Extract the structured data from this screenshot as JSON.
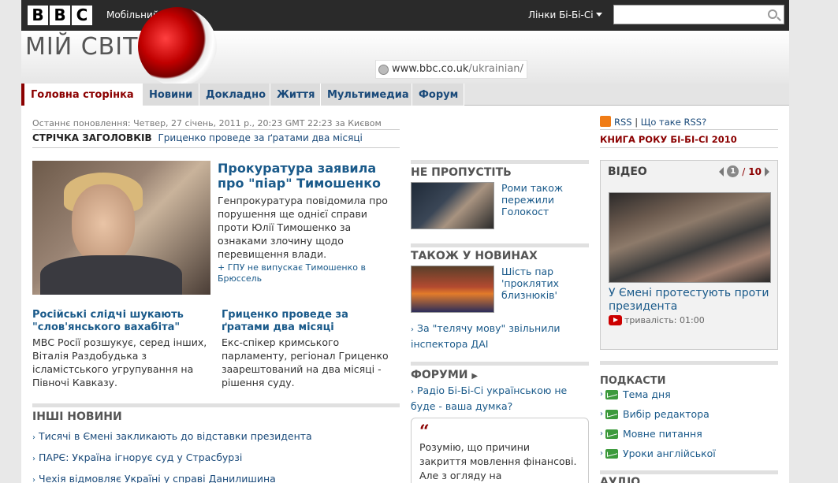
{
  "header": {
    "logo_letters": [
      "B",
      "B",
      "C"
    ],
    "mobile_label": "Мобільний",
    "links_label": "Лінки Бі-Бі-Сі",
    "search_placeholder": ""
  },
  "banner": {
    "brand": "МІЙ СВІТ",
    "url_prefix": "www.bbc.co.uk",
    "url_suffix": "/ukrainian/"
  },
  "nav": {
    "tabs": [
      "Головна сторінка",
      "Новини",
      "Докладно",
      "Життя",
      "Мультимедиа",
      "Форум"
    ],
    "active_index": 0
  },
  "updated": "Останнє поновлення: Четвер, 27 січень, 2011 р., 20:23 GMT 22:23 за Києвом",
  "ticker": {
    "label": "СТРІЧКА ЗАГОЛОВКІВ",
    "headline": "Гриценко проведе за ґратами два місяці"
  },
  "lead": {
    "title": "Прокуратура заявила про \"піар\" Тимошенко",
    "text": "Генпрокуратура повідомила про порушення ще однієї справи проти Юлії Тимошенко за ознаками злочину щодо перевищення влади.",
    "sub_link": "ГПУ не випускає Тимошенко в Брюссель"
  },
  "stories": [
    {
      "title": "Російські слідчі шукають \"слов'янського вахабіта\"",
      "text": "МВС Росії розшукує, серед інших, Віталія Раздобудька з ісламістського угрупування на Півночі Кавказу."
    },
    {
      "title": "Гриценко проведе за ґратами два місяці",
      "text": "Екс-спікер кримського парламенту, регіонал Гриценко заарештований на два місяці - рішення суду."
    }
  ],
  "other_news": {
    "heading": "ІНШІ НОВИНИ",
    "items": [
      "Тисячі в Ємені закликають до відставки президента",
      "ПАРЄ: Україна ігнорує суд у Страсбурзі",
      "Чехія відмовляє Україні у справі Данилишина"
    ]
  },
  "dont_miss": {
    "heading": "НЕ ПРОПУСТІТЬ",
    "story": "Роми також пережили Голокост"
  },
  "also_news": {
    "heading": "ТАКОЖ У НОВИНАХ",
    "story": "Шість пар 'проклятих близнюків'",
    "link": "За \"телячу мову\" звільнили інспектора ДАІ"
  },
  "forums": {
    "heading": "ФОРУМИ",
    "link": "Радіо Бі-Бі-Сі українською не буде - ваша думка?",
    "quote": "Розумію, що причини закриття мовлення фінансові. Але з огляду на"
  },
  "right": {
    "rss": "RSS",
    "rss_sep": "|",
    "rss_what": "Що таке RSS?",
    "book": "КНИГА РОКУ БІ-БІ-СІ 2010",
    "video": {
      "heading": "ВІДЕО",
      "page": "1",
      "sep": "/",
      "total": "10",
      "title": "У Ємені протестують проти президента",
      "duration": "тривалість: 01:00"
    },
    "podcasts": {
      "heading": "ПОДКАСТИ",
      "items": [
        "Тема дня",
        "Вибір редактора",
        "Мовне питання",
        "Уроки англійської"
      ]
    },
    "audio_heading": "АУДІО"
  },
  "colors": {
    "topbar": "#2a2a2a",
    "link": "#1a5a8a",
    "accent": "#8b0000",
    "podcast_icon": "#3c9a3c",
    "rss_icon": "#f07c16"
  }
}
